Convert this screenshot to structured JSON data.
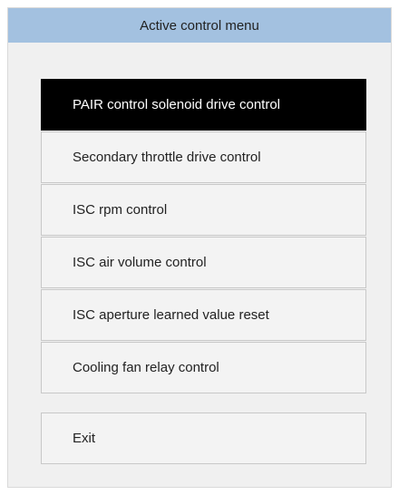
{
  "window": {
    "title": "Active control menu",
    "title_bar_color": "#a3c1e0",
    "background_color": "#f0f0f0"
  },
  "menu": {
    "selected_index": 0,
    "items": [
      {
        "label": "PAIR control solenoid drive control"
      },
      {
        "label": "Secondary throttle drive control"
      },
      {
        "label": "ISC rpm control"
      },
      {
        "label": "ISC air volume control"
      },
      {
        "label": "ISC aperture learned value reset"
      },
      {
        "label": "Cooling fan relay control"
      }
    ],
    "selected_color": "#000000",
    "selected_text_color": "#ffffff"
  },
  "exit": {
    "label": "Exit"
  }
}
